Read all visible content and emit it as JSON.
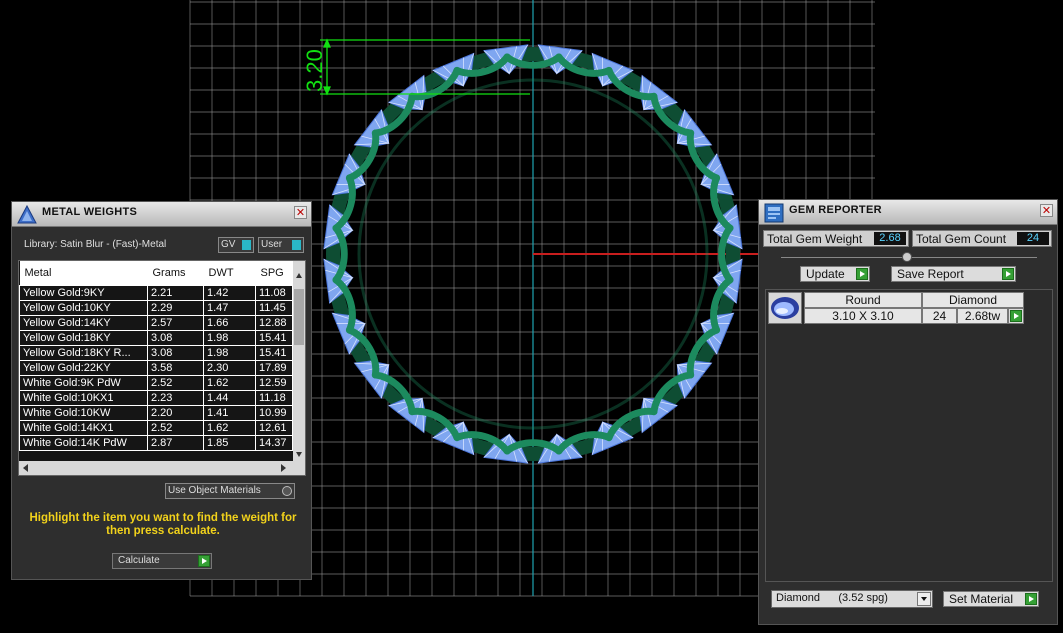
{
  "viewport": {
    "dimension_label": "3.20"
  },
  "metal_weights": {
    "title": "METAL WEIGHTS",
    "library_label": "Library: Satin Blur - (Fast)-Metal",
    "gv_label": "GV",
    "user_label": "User",
    "columns": [
      "Metal",
      "Grams",
      "DWT",
      "SPG"
    ],
    "rows": [
      [
        "Yellow Gold:9KY",
        "2.21",
        "1.42",
        "11.08"
      ],
      [
        "Yellow Gold:10KY",
        "2.29",
        "1.47",
        "11.45"
      ],
      [
        "Yellow Gold:14KY",
        "2.57",
        "1.66",
        "12.88"
      ],
      [
        "Yellow Gold:18KY",
        "3.08",
        "1.98",
        "15.41"
      ],
      [
        "Yellow Gold:18KY R...",
        "3.08",
        "1.98",
        "15.41"
      ],
      [
        "Yellow Gold:22KY",
        "3.58",
        "2.30",
        "17.89"
      ],
      [
        "White Gold:9K PdW",
        "2.52",
        "1.62",
        "12.59"
      ],
      [
        "White Gold:10KX1",
        "2.23",
        "1.44",
        "11.18"
      ],
      [
        "White Gold:10KW",
        "2.20",
        "1.41",
        "10.99"
      ],
      [
        "White Gold:14KX1",
        "2.52",
        "1.62",
        "12.61"
      ],
      [
        "White Gold:14K PdW",
        "2.87",
        "1.85",
        "14.37"
      ]
    ],
    "use_object_materials_label": "Use Object Materials",
    "instruction": "Highlight the item you want to find the weight for then press calculate.",
    "calculate_label": "Calculate"
  },
  "gem_reporter": {
    "title": "GEM REPORTER",
    "total_gem_weight_label": "Total Gem Weight",
    "total_gem_weight_value": "2.68",
    "total_gem_count_label": "Total Gem Count",
    "total_gem_count_value": "24",
    "update_label": "Update",
    "save_report_label": "Save Report",
    "gem": {
      "shape": "Round",
      "material": "Diamond",
      "size": "3.10 X 3.10",
      "count": "24",
      "weight": "2.68tw"
    },
    "material_select_value": "Diamond      (3.52 spg)",
    "set_material_label": "Set Material"
  },
  "colors": {
    "grid": "#9a9a9a",
    "axis_y": "#1fa3b0",
    "axis_x": "#c81e1e",
    "dimension": "#12e012",
    "metal": "#1c8a5e",
    "gem": "#7fa6f0",
    "highlight_text": "#f2d21b"
  },
  "icons": [
    "metal-weights-app-icon",
    "gem-reporter-app-icon",
    "close-icon",
    "go-arrow-icon",
    "scroll-left-icon",
    "scroll-right-icon",
    "scroll-up-icon",
    "scroll-down-icon",
    "dropdown-arrow-icon",
    "round-gem-thumbnail-icon"
  ]
}
